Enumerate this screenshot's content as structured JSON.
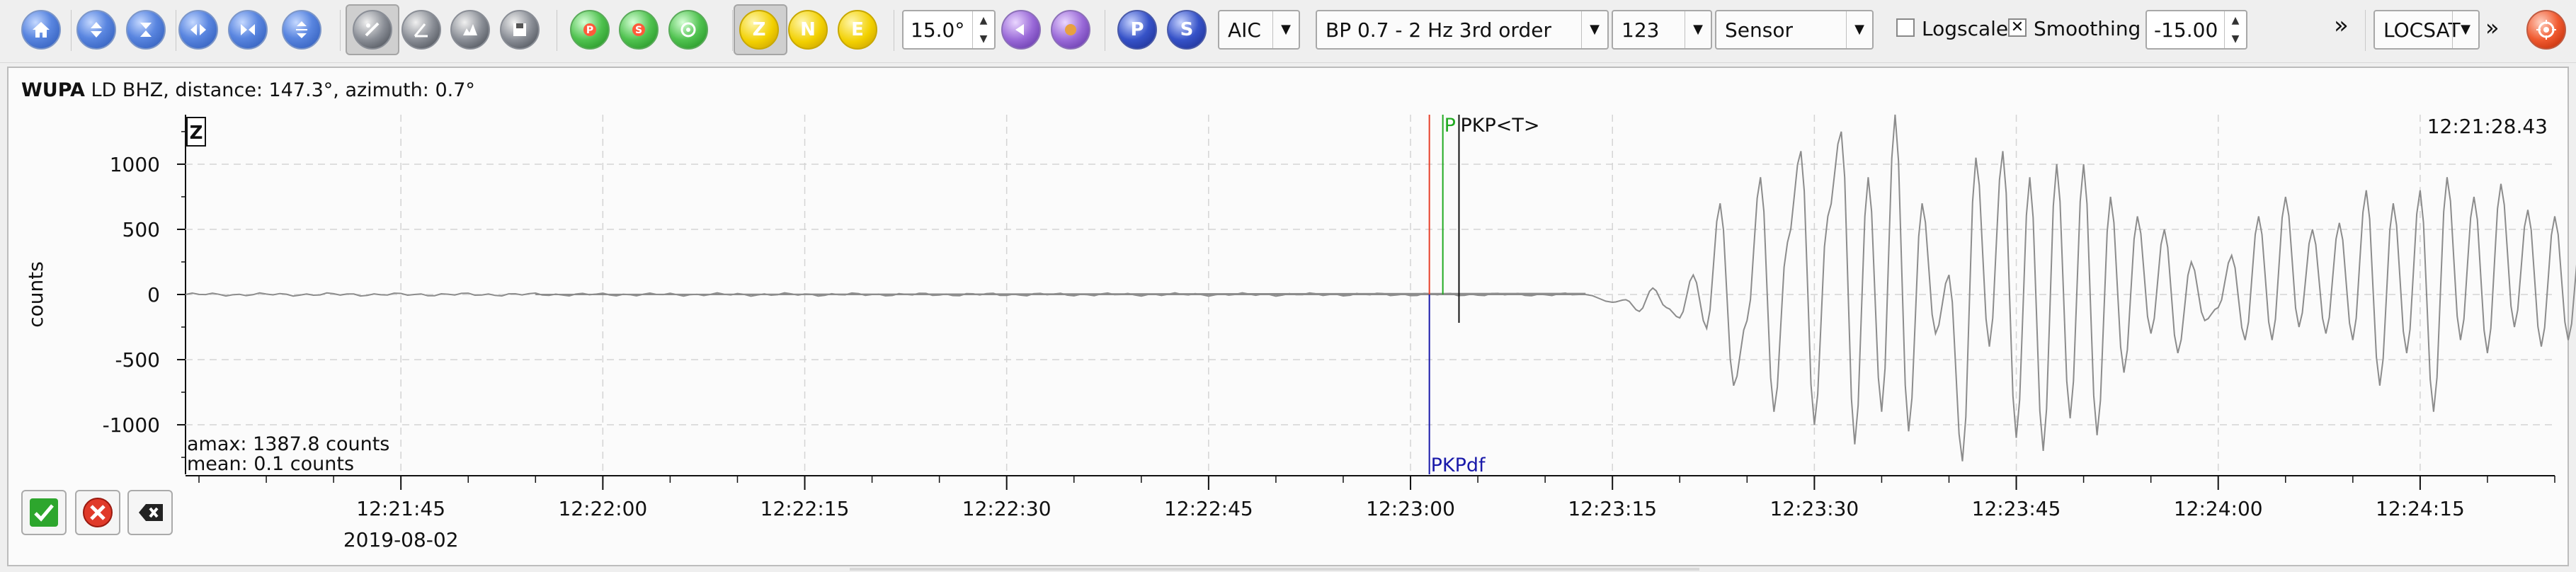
{
  "toolbar": {
    "distance_value": "15.0°",
    "picker": "AIC",
    "filter": "BP 0.7 - 2 Hz  3rd order",
    "component_value": "123",
    "unit": "Sensor",
    "logscale_label": "Logscale",
    "logscale_checked": false,
    "smoothing_label": "Smoothing",
    "smoothing_checked": true,
    "min_amplitude": "-15.00",
    "locator": "LOCSAT",
    "overflow": "»",
    "phase_buttons": {
      "z": "Z",
      "n": "N",
      "e": "E",
      "p": "P",
      "s": "S"
    }
  },
  "trace": {
    "station": "WUPA",
    "network_and_channel": " LD  BHZ, distance: 147.3°, azimuth: 0.7°",
    "component_label": "Z",
    "ylabel": "counts",
    "time_label": "12:21:28.43",
    "amax": "amax: 1387.8 counts",
    "mean": "mean: 0.1 counts",
    "date": "2019-08-02"
  },
  "picks": [
    {
      "label": "",
      "color": "#e8402a",
      "time": "12:23:01.4"
    },
    {
      "label": "P",
      "color": "#22aa22",
      "time": "12:23:02.4"
    },
    {
      "label": "PKP<T>",
      "color": "#111111",
      "time": "12:23:03.6"
    },
    {
      "label": "PKPdf",
      "color": "#1a1aaa",
      "time": "12:23:01.4"
    }
  ],
  "chart_data": {
    "type": "line",
    "ylabel": "counts",
    "ylim": [
      -1380,
      1380
    ],
    "yticks": [
      1000,
      500,
      0,
      -500,
      -1000
    ],
    "xticks": [
      "12:21:45",
      "12:22:00",
      "12:22:15",
      "12:22:30",
      "12:22:45",
      "12:23:00",
      "12:23:15",
      "12:23:30",
      "12:23:45",
      "12:24:00",
      "12:24:15"
    ],
    "grid": true,
    "series": [
      {
        "x_start": "12:21:29",
        "x_end": "12:24:25",
        "points": [
          [
            0,
            0
          ],
          [
            104,
            0
          ],
          [
            106,
            -60
          ],
          [
            107,
            -40
          ],
          [
            108,
            -130
          ],
          [
            109,
            50
          ],
          [
            110,
            -100
          ],
          [
            111,
            -180
          ],
          [
            112,
            150
          ],
          [
            113,
            -260
          ],
          [
            114,
            700
          ],
          [
            115,
            -700
          ],
          [
            116,
            -200
          ],
          [
            117,
            900
          ],
          [
            118,
            -900
          ],
          [
            119,
            400
          ],
          [
            120,
            1100
          ],
          [
            121,
            -1000
          ],
          [
            122,
            600
          ],
          [
            123,
            1250
          ],
          [
            124,
            -1150
          ],
          [
            125,
            900
          ],
          [
            126,
            -900
          ],
          [
            127,
            1380
          ],
          [
            128,
            -1050
          ],
          [
            129,
            700
          ],
          [
            130,
            -300
          ],
          [
            131,
            150
          ],
          [
            132,
            -1280
          ],
          [
            133,
            1050
          ],
          [
            134,
            -400
          ],
          [
            135,
            1100
          ],
          [
            136,
            -1100
          ],
          [
            137,
            900
          ],
          [
            138,
            -1200
          ],
          [
            139,
            1000
          ],
          [
            140,
            -950
          ],
          [
            141,
            1000
          ],
          [
            142,
            -1080
          ],
          [
            143,
            750
          ],
          [
            144,
            -600
          ],
          [
            145,
            600
          ],
          [
            146,
            -300
          ],
          [
            147,
            500
          ],
          [
            148,
            -450
          ],
          [
            149,
            250
          ],
          [
            150,
            -200
          ],
          [
            151,
            -100
          ],
          [
            152,
            300
          ],
          [
            153,
            -350
          ],
          [
            154,
            600
          ],
          [
            155,
            -350
          ],
          [
            156,
            750
          ],
          [
            157,
            -250
          ],
          [
            158,
            500
          ],
          [
            159,
            -300
          ],
          [
            160,
            550
          ],
          [
            161,
            -350
          ],
          [
            162,
            800
          ],
          [
            163,
            -700
          ],
          [
            164,
            700
          ],
          [
            165,
            -450
          ],
          [
            166,
            800
          ],
          [
            167,
            -900
          ],
          [
            168,
            900
          ],
          [
            169,
            -350
          ],
          [
            170,
            750
          ],
          [
            171,
            -450
          ],
          [
            172,
            850
          ],
          [
            173,
            -250
          ],
          [
            174,
            650
          ],
          [
            175,
            -400
          ],
          [
            176,
            600
          ],
          [
            177,
            -350
          ],
          [
            178,
            500
          ],
          [
            179,
            -400
          ],
          [
            180,
            550
          ],
          [
            181,
            -300
          ],
          [
            182,
            750
          ],
          [
            183,
            -450
          ],
          [
            184,
            600
          ],
          [
            185,
            -350
          ],
          [
            186,
            500
          ],
          [
            187,
            -350
          ],
          [
            188,
            550
          ],
          [
            189,
            -450
          ],
          [
            190,
            700
          ],
          [
            191,
            -350
          ],
          [
            192,
            600
          ],
          [
            193,
            -300
          ],
          [
            194,
            550
          ],
          [
            195,
            -250
          ],
          [
            196,
            650
          ],
          [
            197,
            -300
          ],
          [
            198,
            450
          ],
          [
            199,
            -200
          ],
          [
            200,
            500
          ],
          [
            201,
            -250
          ],
          [
            202,
            550
          ],
          [
            203,
            -250
          ],
          [
            204,
            500
          ],
          [
            205,
            -150
          ],
          [
            206,
            350
          ],
          [
            207,
            -100
          ],
          [
            208,
            450
          ],
          [
            209,
            -150
          ],
          [
            210,
            200
          ],
          [
            211,
            -100
          ],
          [
            212,
            300
          ],
          [
            213,
            -150
          ],
          [
            214,
            200
          ]
        ]
      }
    ]
  }
}
